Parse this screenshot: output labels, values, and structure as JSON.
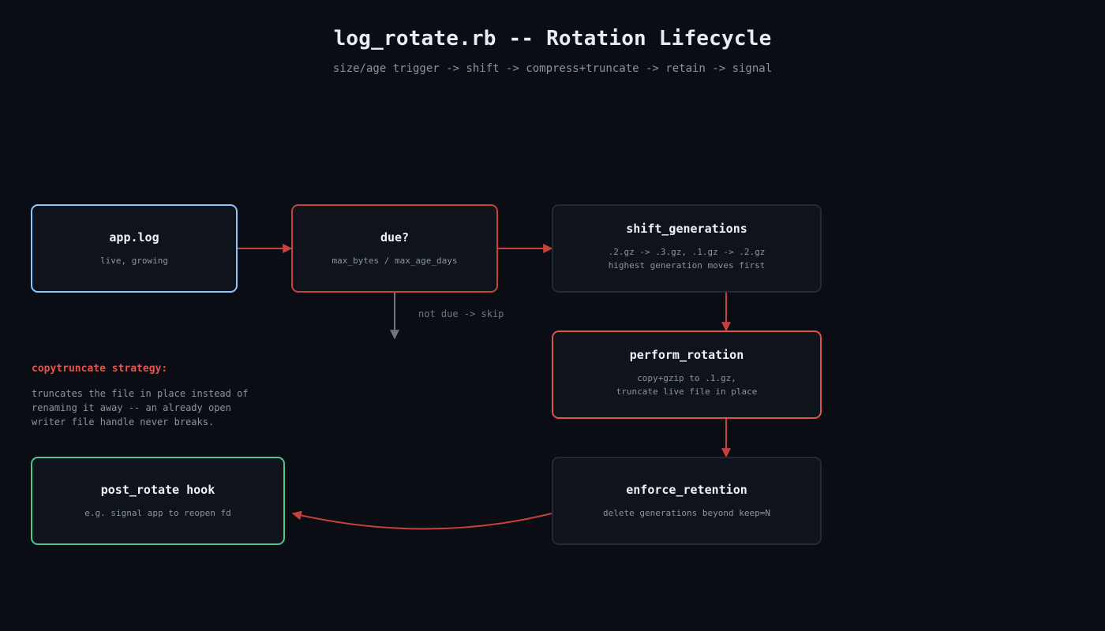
{
  "header": {
    "title": "log_rotate.rb -- Rotation Lifecycle",
    "subtitle": "size/age trigger -> shift -> compress+truncate -> retain -> signal"
  },
  "nodes": {
    "app_log": {
      "title": "app.log",
      "subtitle": "live, growing"
    },
    "due": {
      "title": "due?",
      "subtitle": "max_bytes / max_age_days"
    },
    "shift": {
      "title": "shift_generations",
      "lines": [
        ".2.gz -> .3.gz, .1.gz -> .2.gz",
        "highest generation moves first"
      ]
    },
    "perform": {
      "title": "perform_rotation",
      "lines": [
        "copy+gzip to .1.gz,",
        "truncate live file in place"
      ]
    },
    "retain": {
      "title": "enforce_retention",
      "subtitle": "delete generations beyond keep=N"
    },
    "hook": {
      "title": "post_rotate hook",
      "subtitle": "e.g. signal app to reopen fd"
    }
  },
  "edges": {
    "skip_label": "not due -> skip"
  },
  "note": {
    "title": "copytruncate strategy:",
    "lines": [
      "truncates the file in place instead of",
      "renaming it away -- an already open",
      "writer file handle never breaks."
    ]
  },
  "colors": {
    "background": "#0a0d14",
    "edge_active": "#c7423c",
    "edge_skip": "#6e7681",
    "border_input": "#8cc6ff",
    "border_decision": "#c7423c",
    "border_output": "#4cc792"
  }
}
